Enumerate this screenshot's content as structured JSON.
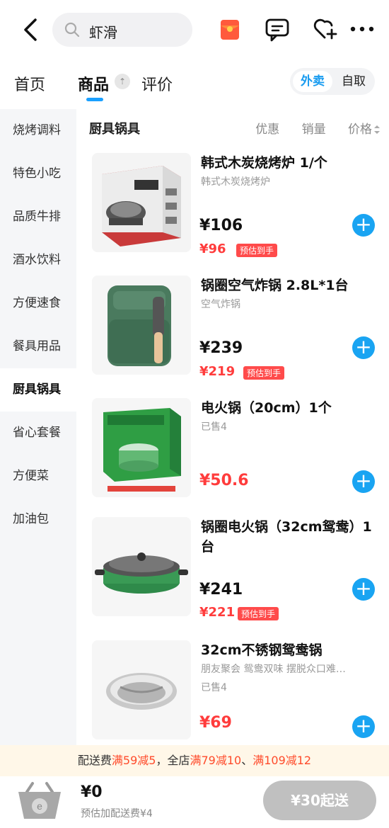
{
  "search": {
    "query": "虾滑"
  },
  "tabs": [
    {
      "label": "首页"
    },
    {
      "label": "商品"
    },
    {
      "label": "评价"
    }
  ],
  "mode_toggle": {
    "delivery": "外卖",
    "pickup": "自取"
  },
  "sidebar": {
    "items": [
      {
        "label": "烧烤调料"
      },
      {
        "label": "特色小吃"
      },
      {
        "label": "品质牛排"
      },
      {
        "label": "酒水饮料"
      },
      {
        "label": "方便速食"
      },
      {
        "label": "餐具用品"
      },
      {
        "label": "厨具锅具"
      },
      {
        "label": "省心套餐"
      },
      {
        "label": "方便菜"
      },
      {
        "label": "加油包"
      }
    ],
    "active_index": 6
  },
  "section": {
    "title": "厨具锅具",
    "sort_discount": "优惠",
    "sort_sales": "销量",
    "sort_price": "价格"
  },
  "products": [
    {
      "name": "韩式木炭烧烤炉 1/个",
      "desc": "韩式木炭烧烤炉",
      "price": "¥106",
      "est_price": "¥96",
      "est_tag": "预估到手"
    },
    {
      "name": "锅圈空气炸锅 2.8L*1台",
      "desc": "空气炸锅",
      "price": "¥239",
      "est_price": "¥219",
      "est_tag": "预估到手"
    },
    {
      "name": "电火锅（20cm）1个",
      "desc": "已售4",
      "price": "¥50.6"
    },
    {
      "name": "锅圈电火锅（32cm鸳鸯）1台",
      "desc": "",
      "price": "¥241",
      "est_price": "¥221",
      "est_tag": "预估到手"
    },
    {
      "name": "32cm不锈钢鸳鸯锅",
      "desc": "朋友聚会  鸳鸯双味 摆脱众口难…",
      "desc2": "已售4",
      "price": "¥69"
    }
  ],
  "promo": {
    "part1": "配送费",
    "part2": "满59减5",
    "part3": "，全店",
    "part4": "满79减10",
    "part5": "、",
    "part6": "满109减12"
  },
  "cart": {
    "amount": "¥0",
    "fee_note": "预估加配送费¥4",
    "checkout_label": "¥30起送"
  },
  "colors": {
    "accent": "#19a4f2",
    "price_red": "#ff3c3c"
  }
}
